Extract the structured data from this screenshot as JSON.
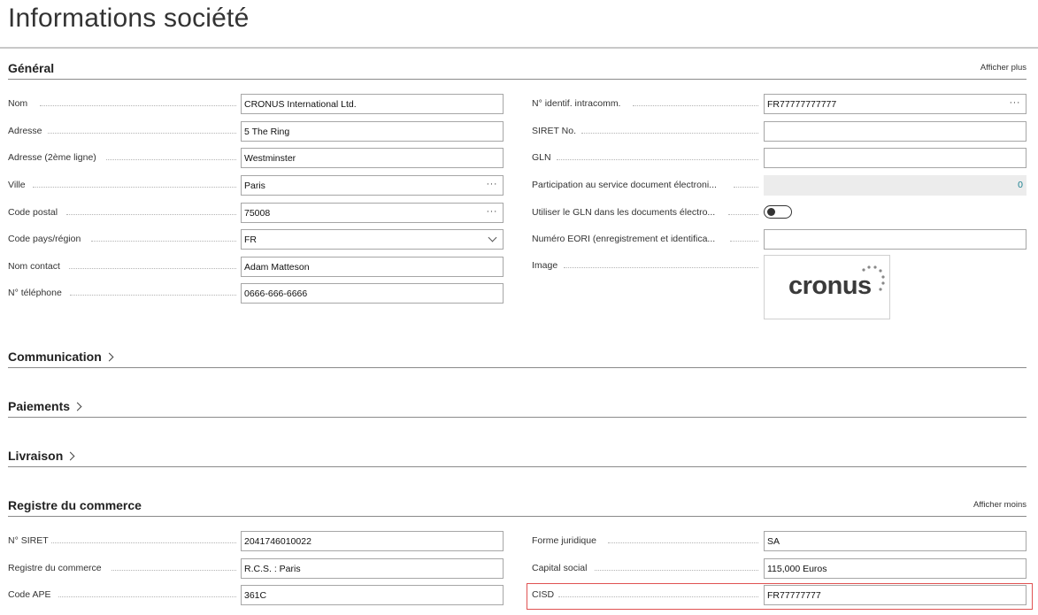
{
  "page": {
    "title": "Informations société"
  },
  "general": {
    "title": "Général",
    "action": "Afficher plus",
    "left": [
      {
        "label": "Nom",
        "value": "CRONUS International Ltd.",
        "kind": "text"
      },
      {
        "label": "Adresse",
        "value": "5 The Ring",
        "kind": "text"
      },
      {
        "label": "Adresse (2ème ligne)",
        "value": "Westminster",
        "kind": "text"
      },
      {
        "label": "Ville",
        "value": "Paris",
        "kind": "lookup"
      },
      {
        "label": "Code postal",
        "value": "75008",
        "kind": "lookup"
      },
      {
        "label": "Code pays/région",
        "value": "FR",
        "kind": "dropdown"
      },
      {
        "label": "Nom contact",
        "value": "Adam Matteson",
        "kind": "text"
      },
      {
        "label": "N° téléphone",
        "value": "0666-666-6666",
        "kind": "text"
      }
    ],
    "right": [
      {
        "label": "N° identif. intracomm.",
        "value": "FR77777777777",
        "kind": "lookup"
      },
      {
        "label": "SIRET No.",
        "value": "",
        "kind": "text"
      },
      {
        "label": "GLN",
        "value": "",
        "kind": "text"
      },
      {
        "label": "Participation au service document électroni...",
        "value": "0",
        "kind": "readonly"
      },
      {
        "label": "Utiliser le GLN dans les documents électro...",
        "value": "",
        "kind": "toggle",
        "toggle_on": false
      },
      {
        "label": "Numéro EORI (enregistrement et identifica...",
        "value": "",
        "kind": "text"
      },
      {
        "label": "Image",
        "value": "cronus",
        "kind": "image"
      }
    ],
    "assist_glyph": "···"
  },
  "sections": [
    {
      "title": "Communication"
    },
    {
      "title": "Paiements"
    },
    {
      "title": "Livraison"
    }
  ],
  "registre": {
    "title": "Registre du commerce",
    "action": "Afficher moins",
    "left": [
      {
        "label": "N° SIRET",
        "value": "2041746010022"
      },
      {
        "label": "Registre du commerce",
        "value": "R.C.S. : Paris"
      },
      {
        "label": "Code APE",
        "value": "361C"
      }
    ],
    "right": [
      {
        "label": "Forme juridique",
        "value": "SA"
      },
      {
        "label": "Capital social",
        "value": "115,000 Euros"
      },
      {
        "label": "CISD",
        "value": "FR77777777"
      }
    ]
  },
  "colors": {
    "highlight": "#e05252",
    "readonly_value": "#1a7f8f"
  }
}
